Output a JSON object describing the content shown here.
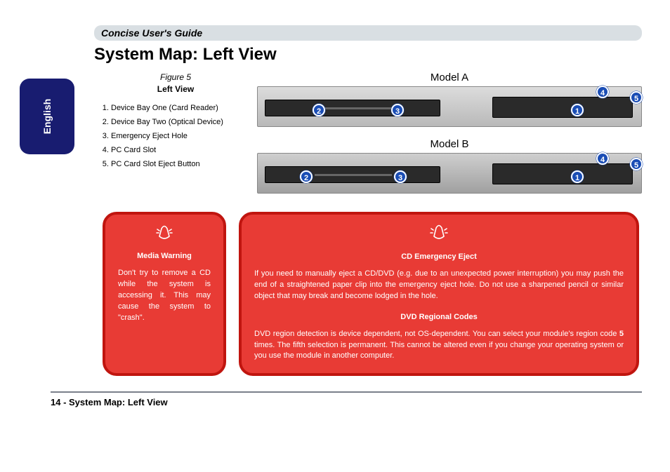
{
  "header": "Concise User's Guide",
  "language": "English",
  "page_title": "System Map: Left View",
  "figure": {
    "caption": "Figure 5",
    "subcaption": "Left View"
  },
  "legend": [
    "Device Bay One (Card Reader)",
    "Device Bay Two (Optical Device)",
    "Emergency Eject Hole",
    "PC Card Slot",
    "PC Card Slot Eject Button"
  ],
  "models": {
    "a": "Model A",
    "b": "Model B"
  },
  "callouts": {
    "1": "1",
    "2": "2",
    "3": "3",
    "4": "4",
    "5": "5"
  },
  "warn_small": {
    "title": "Media Warning",
    "body": "Don't try to remove a CD while the system is accessing it. This may cause the system to \"crash\"."
  },
  "warn_large": {
    "title1": "CD Emergency Eject",
    "body1": "If you need to manually eject a CD/DVD (e.g. due to an unexpected power interruption) you may push the end of a straightened paper clip into the emergency eject hole. Do not use a sharpened pencil or similar object that may break and become lodged in the hole.",
    "title2": "DVD Regional Codes",
    "body2a": "DVD region detection is device dependent, not OS-dependent. You can select your module's region code ",
    "body2_bold": "5",
    "body2b": " times. The fifth selection is permanent. This cannot be altered even if you change your operating system or you use the module in another computer."
  },
  "footer": {
    "page": "14 - ",
    "title": "System Map: Left View"
  }
}
